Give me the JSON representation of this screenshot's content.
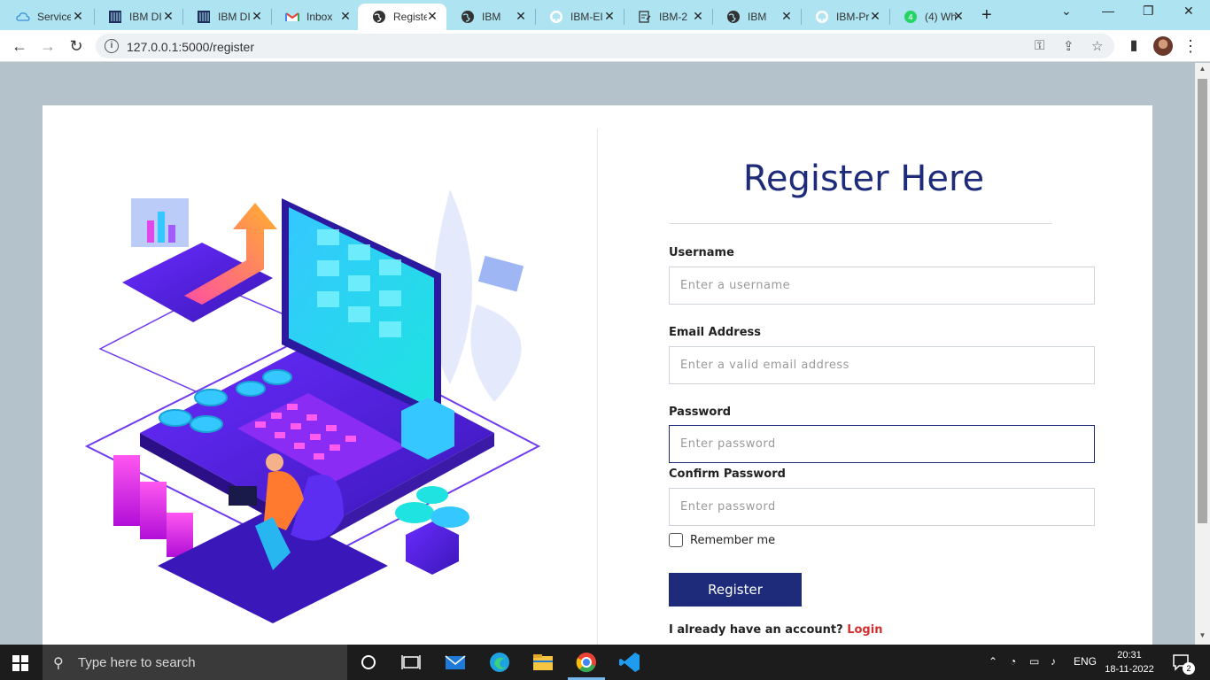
{
  "browser": {
    "tabs": [
      {
        "title": "Service",
        "icon": "cloud-icon"
      },
      {
        "title": "IBM DI",
        "icon": "grid-icon"
      },
      {
        "title": "IBM DI",
        "icon": "grid-icon"
      },
      {
        "title": "Inbox",
        "icon": "gmail-icon"
      },
      {
        "title": "Registe",
        "icon": "globe-icon",
        "active": true
      },
      {
        "title": "IBM",
        "icon": "globe-icon"
      },
      {
        "title": "IBM-EI",
        "icon": "github-icon"
      },
      {
        "title": "IBM-2",
        "icon": "doc-icon"
      },
      {
        "title": "IBM",
        "icon": "globe-icon"
      },
      {
        "title": "IBM-Pr",
        "icon": "github-icon"
      },
      {
        "title": "(4) Wh",
        "icon": "whatsapp-icon"
      }
    ],
    "url": "127.0.0.1:5000/register"
  },
  "page": {
    "title": "Register Here",
    "username": {
      "label": "Username",
      "placeholder": "Enter a username"
    },
    "email": {
      "label": "Email Address",
      "placeholder": "Enter a valid email address"
    },
    "password": {
      "label": "Password",
      "placeholder": "Enter password"
    },
    "confirm": {
      "label": "Confirm Password",
      "placeholder": "Enter password"
    },
    "remember_label": "Remember me",
    "register_label": "Register",
    "account_text": "I already have an account?",
    "login_link": "Login",
    "colors": {
      "primary": "#1d2b7a",
      "link": "#d32f2f",
      "background": "#b4c2cb"
    }
  },
  "taskbar": {
    "search_placeholder": "Type here to search",
    "language": "ENG",
    "time": "20:31",
    "date": "18-11-2022",
    "notification_count": "2"
  }
}
